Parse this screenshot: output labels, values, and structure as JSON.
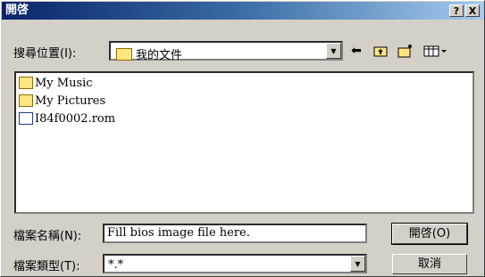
{
  "window": {
    "title": "開啓"
  },
  "titlebar": {
    "help_label": "?",
    "close_label": "X"
  },
  "lookin": {
    "label": "搜尋位置(I):",
    "value": "我的文件"
  },
  "toolbar": {
    "back_icon": "back-arrow-icon",
    "up_icon": "up-folder-icon",
    "newfolder_icon": "new-folder-icon",
    "view_icon": "view-menu-icon"
  },
  "files": [
    {
      "name": "My Music",
      "type": "folder"
    },
    {
      "name": "My Pictures",
      "type": "folder"
    },
    {
      "name": "I84f0002.rom",
      "type": "file"
    }
  ],
  "filename": {
    "label": "檔案名稱(N):",
    "value": "Fill bios image file here."
  },
  "filetype": {
    "label": "檔案類型(T):",
    "value": "*.*"
  },
  "buttons": {
    "open": "開啓(O)",
    "cancel": "取消"
  }
}
